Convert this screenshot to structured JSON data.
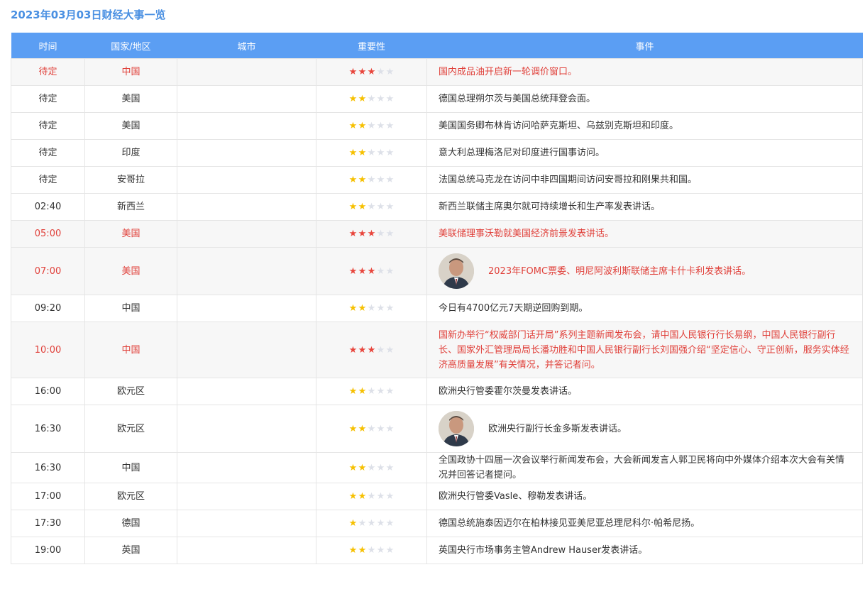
{
  "page": {
    "title": "2023年03月03日财经大事一览"
  },
  "table": {
    "headers": [
      "时间",
      "国家/地区",
      "城市",
      "重要性",
      "事件"
    ],
    "rows": [
      {
        "time": "待定",
        "country": "中国",
        "city": "",
        "stars": 3,
        "important": true,
        "event": "国内成品油开启新一轮调价窗口。",
        "avatar": null
      },
      {
        "time": "待定",
        "country": "美国",
        "city": "",
        "stars": 2,
        "important": false,
        "event": "德国总理朔尔茨与美国总统拜登会面。",
        "avatar": null
      },
      {
        "time": "待定",
        "country": "美国",
        "city": "",
        "stars": 2,
        "important": false,
        "event": "美国国务卿布林肯访问哈萨克斯坦、乌兹别克斯坦和印度。",
        "avatar": null
      },
      {
        "time": "待定",
        "country": "印度",
        "city": "",
        "stars": 2,
        "important": false,
        "event": "意大利总理梅洛尼对印度进行国事访问。",
        "avatar": null
      },
      {
        "time": "待定",
        "country": "安哥拉",
        "city": "",
        "stars": 2,
        "important": false,
        "event": "法国总统马克龙在访问中非四国期间访问安哥拉和刚果共和国。",
        "avatar": null
      },
      {
        "time": "02:40",
        "country": "新西兰",
        "city": "",
        "stars": 2,
        "important": false,
        "event": "新西兰联储主席奥尔就可持续增长和生产率发表讲话。",
        "avatar": null
      },
      {
        "time": "05:00",
        "country": "美国",
        "city": "",
        "stars": 3,
        "important": true,
        "event": "美联储理事沃勒就美国经济前景发表讲话。",
        "avatar": null
      },
      {
        "time": "07:00",
        "country": "美国",
        "city": "",
        "stars": 3,
        "important": true,
        "event": "2023年FOMC票委、明尼阿波利斯联储主席卡什卡利发表讲话。",
        "avatar": "speaker-photo"
      },
      {
        "time": "09:20",
        "country": "中国",
        "city": "",
        "stars": 2,
        "important": false,
        "event": "今日有4700亿元7天期逆回购到期。",
        "avatar": null
      },
      {
        "time": "10:00",
        "country": "中国",
        "city": "",
        "stars": 3,
        "important": true,
        "event": "国新办举行“权威部门话开局”系列主题新闻发布会，请中国人民银行行长易纲，中国人民银行副行长、国家外汇管理局局长潘功胜和中国人民银行副行长刘国强介绍“坚定信心、守正创新，服务实体经济高质量发展”有关情况，并答记者问。",
        "avatar": null
      },
      {
        "time": "16:00",
        "country": "欧元区",
        "city": "",
        "stars": 2,
        "important": false,
        "event": "欧洲央行管委霍尔茨曼发表讲话。",
        "avatar": null
      },
      {
        "time": "16:30",
        "country": "欧元区",
        "city": "",
        "stars": 2,
        "important": false,
        "event": "欧洲央行副行长金多斯发表讲话。",
        "avatar": "speaker-photo"
      },
      {
        "time": "16:30",
        "country": "中国",
        "city": "",
        "stars": 2,
        "important": false,
        "event": "全国政协十四届一次会议举行新闻发布会，大会新闻发言人郭卫民将向中外媒体介绍本次大会有关情况并回答记者提问。",
        "avatar": null
      },
      {
        "time": "17:00",
        "country": "欧元区",
        "city": "",
        "stars": 2,
        "important": false,
        "event": "欧洲央行管委Vasle、穆勒发表讲话。",
        "avatar": null
      },
      {
        "time": "17:30",
        "country": "德国",
        "city": "",
        "stars": 1,
        "important": false,
        "event": "德国总统施泰因迈尔在柏林接见亚美尼亚总理尼科尔·帕希尼扬。",
        "avatar": null
      },
      {
        "time": "19:00",
        "country": "英国",
        "city": "",
        "stars": 2,
        "important": false,
        "event": "英国央行市场事务主管Andrew Hauser发表讲话。",
        "avatar": null
      }
    ]
  },
  "colors": {
    "header_bg": "#5b9ef3",
    "title": "#4a90e2",
    "important_text": "#e0403a",
    "star_red": "#e8453c",
    "star_yellow": "#f6c000",
    "star_off": "#dde0e8"
  }
}
